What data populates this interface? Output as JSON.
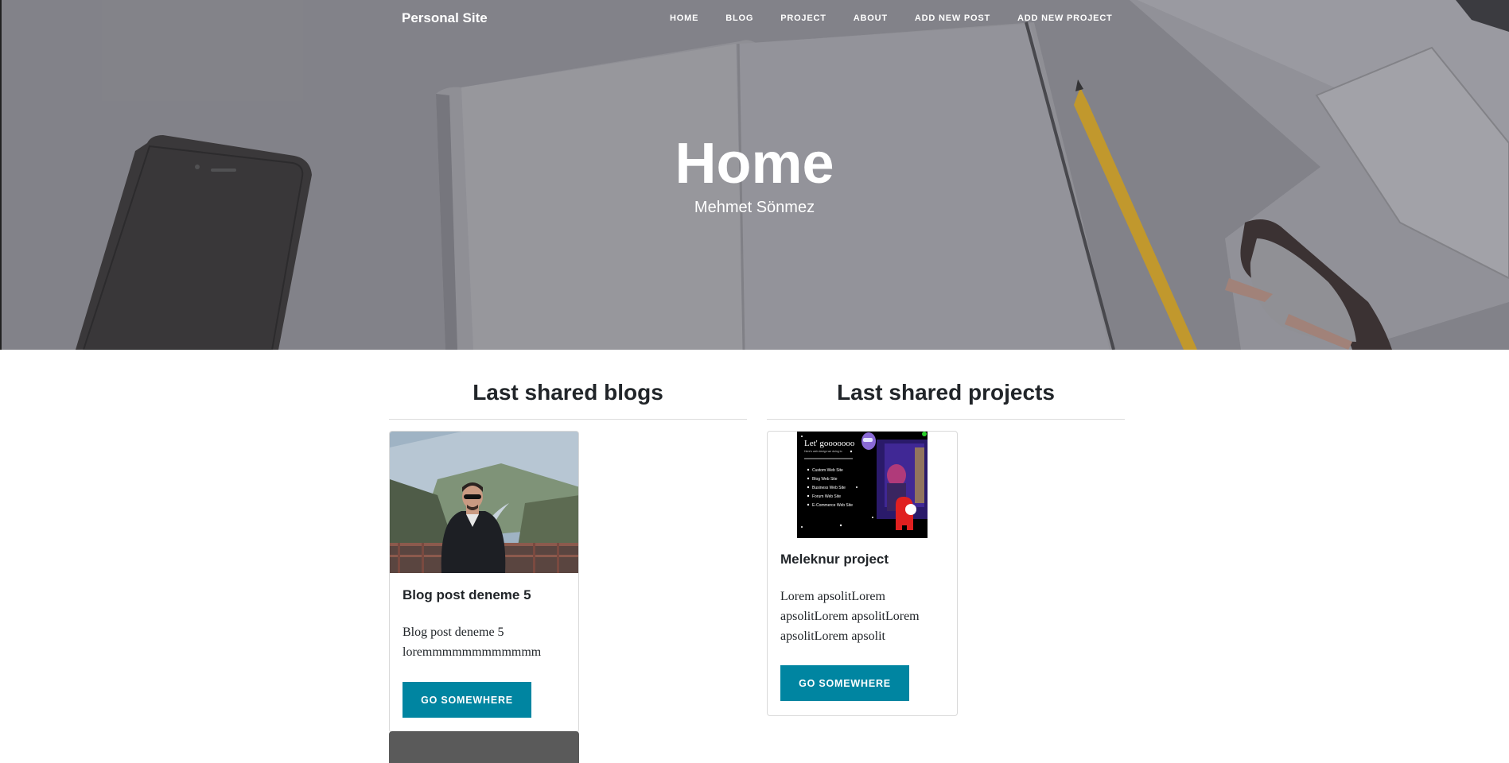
{
  "nav": {
    "brand": "Personal Site",
    "links": [
      "HOME",
      "BLOG",
      "PROJECT",
      "ABOUT",
      "ADD NEW POST",
      "ADD NEW PROJECT"
    ]
  },
  "hero": {
    "title": "Home",
    "subtitle": "Mehmet Sönmez"
  },
  "blogs": {
    "heading": "Last shared blogs",
    "cards": [
      {
        "title": "Blog post deneme 5",
        "text": "Blog post deneme 5 loremmmmmmmmmmmm",
        "button": "GO SOMEWHERE"
      }
    ]
  },
  "projects": {
    "heading": "Last shared projects",
    "cards": [
      {
        "title": "Meleknur project",
        "text": "Lorem apsolitLorem apsolitLorem apsolitLorem apsolitLorem apsolit",
        "button": "GO SOMEWHERE",
        "image_text": {
          "headline": "Let' gooooooo",
          "tagline": "Here's web design we doing to",
          "items": [
            "Custom Web Site",
            "Blog Web Site",
            "Business Web Site",
            "Forum Web Site",
            "E-Commerce Web Site"
          ]
        }
      }
    ]
  },
  "colors": {
    "accent": "#0085a1",
    "text": "#212529"
  }
}
